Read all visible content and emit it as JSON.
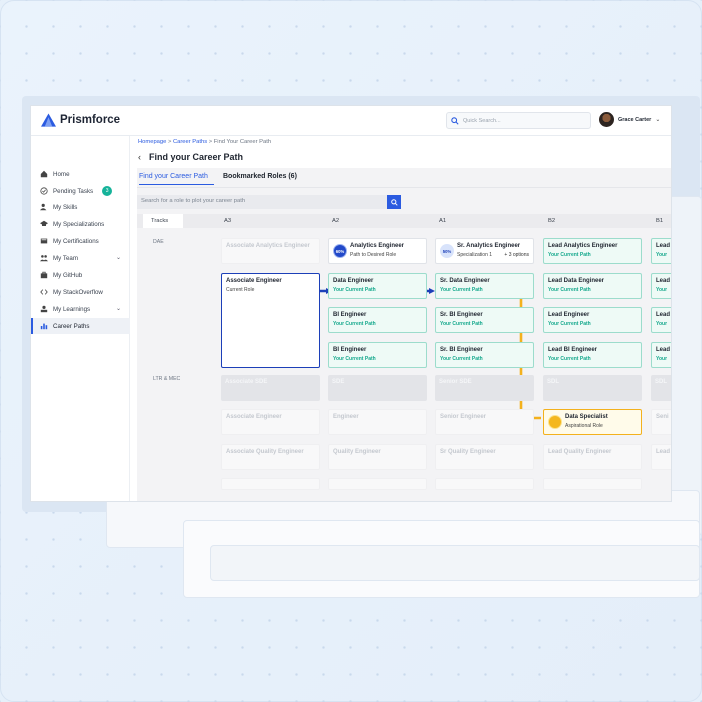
{
  "app": {
    "brand": "Prismforce",
    "search_placeholder": "Quick Search...",
    "user_name": "Grace Carter"
  },
  "sidebar": {
    "items": [
      {
        "label": "Home",
        "icon": "home-icon"
      },
      {
        "label": "Pending Tasks",
        "icon": "check-circle-icon",
        "badge": "3"
      },
      {
        "label": "My Skills",
        "icon": "skills-icon"
      },
      {
        "label": "My Specializations",
        "icon": "graduation-cap-icon"
      },
      {
        "label": "My Certifications",
        "icon": "certificate-icon"
      },
      {
        "label": "My Team",
        "icon": "team-icon",
        "expandable": true
      },
      {
        "label": "My GitHub",
        "icon": "briefcase-icon"
      },
      {
        "label": "My StackOverflow",
        "icon": "code-icon"
      },
      {
        "label": "My Learnings",
        "icon": "learning-icon",
        "expandable": true
      },
      {
        "label": "Career Paths",
        "icon": "bar-chart-icon",
        "active": true
      }
    ]
  },
  "breadcrumb": {
    "home": "Homepage",
    "sep1": " > ",
    "career": "Career Paths",
    "sep2": " > ",
    "current": "Find Your Career Path"
  },
  "page": {
    "title": "Find your Career Path",
    "tabs": [
      "Find your Career Path",
      "Bookmarked Roles (6)"
    ],
    "search_placeholder": "Search for a role to plot your career path"
  },
  "grid": {
    "tracks_header": "Tracks",
    "columns": [
      "A3",
      "A2",
      "A1",
      "B2",
      "B1"
    ],
    "track_labels": [
      "DAE",
      "LTR & MEC"
    ]
  },
  "cards": {
    "assoc_analytics": "Associate Analytics Engineer",
    "analytics_eng": {
      "name": "Analytics Engineer",
      "sub": "Path to Desired Role",
      "pct": "60%"
    },
    "sr_analytics": {
      "name": "Sr. Analytics Engineer",
      "sub": "Specialization 1",
      "opts": "+ 3 options",
      "pct": "50%"
    },
    "lead_analytics": {
      "name": "Lead Analytics Engineer",
      "sub": "Your Current Path"
    },
    "assoc_eng": {
      "name": "Associate Engineer",
      "sub": "Current Role"
    },
    "data_eng": {
      "name": "Data Engineer",
      "sub": "Your Current Path"
    },
    "sr_data_eng": {
      "name": "Sr. Data  Engineer",
      "sub": "Your Current Path"
    },
    "lead_data_eng": {
      "name": "Lead Data Engineer",
      "sub": "Your Current Path"
    },
    "bi_eng_1": {
      "name": "BI Engineer",
      "sub": "Your Current Path"
    },
    "sr_bi_eng_1": {
      "name": "Sr. BI Engineer",
      "sub": "Your Current Path"
    },
    "lead_eng": {
      "name": "Lead Engineer",
      "sub": "Your Current Path"
    },
    "bi_eng_2": {
      "name": "BI Engineer",
      "sub": "Your Current Path"
    },
    "sr_bi_eng_2": {
      "name": "Sr. BI Engineer",
      "sub": "Your Current Path"
    },
    "lead_bi_eng": {
      "name": "Lead BI Engineer",
      "sub": "Your Current Path"
    },
    "edge_lead": "Lead",
    "edge_your": "Your",
    "gray_row": [
      "Associate SDE",
      "SDE",
      "Senior SDE",
      "SDL",
      "SDL"
    ],
    "ghost_row1": [
      "Associate Engineer",
      "Engineer",
      "Senior Engineer",
      "Seni"
    ],
    "data_specialist": {
      "name": "Data Specialist",
      "sub": "Aspirational Role"
    },
    "ghost_row2": [
      "Associate Quality Engineer",
      "Quality Engineer",
      "Sr Quality Engineer",
      "Lead Quality Engineer",
      "Lead"
    ]
  },
  "colors": {
    "accent": "#2b5be0",
    "current_border": "#1c3fb8",
    "green_border": "#9cdccc",
    "green_text": "#14a88c",
    "aspiration": "#f3b11d"
  }
}
